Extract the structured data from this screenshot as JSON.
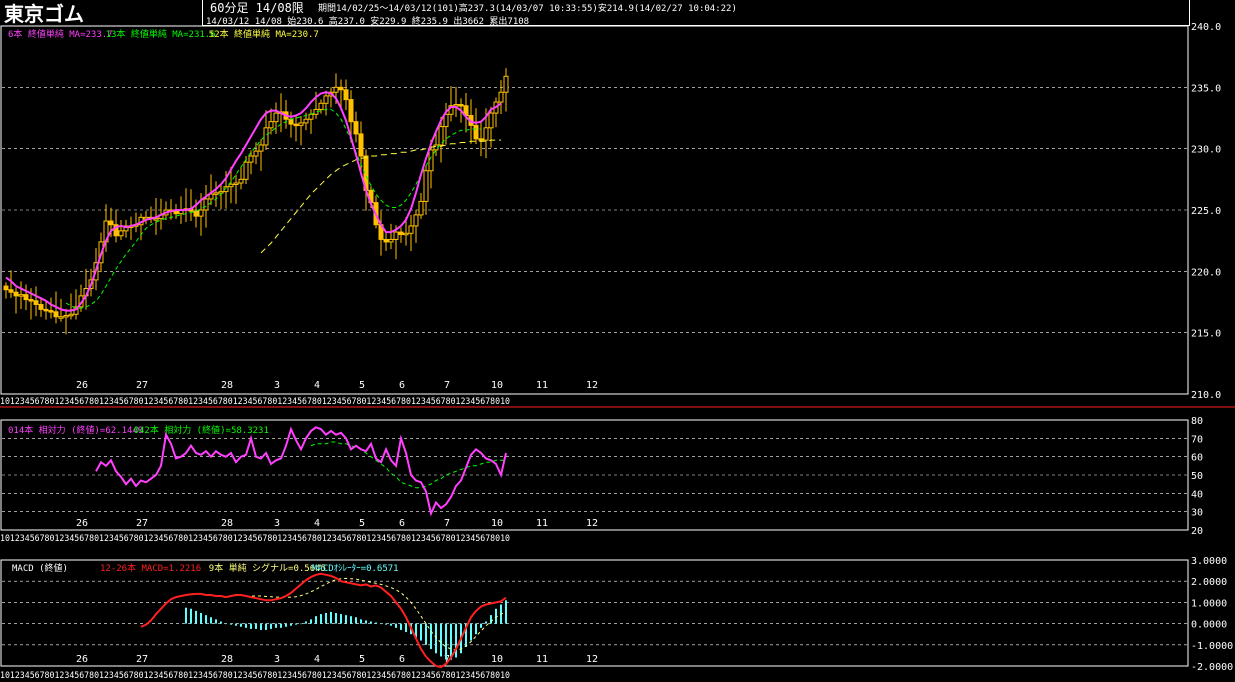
{
  "header": {
    "title": "東京ゴム",
    "timeframe": "60分足 14/08限",
    "period": "期間14/02/25～14/03/12(101)高237.3(14/03/07 10:33:55)安214.9(14/02/27 10:04:22)",
    "last_bar": "14/03/12 14/08 始230.6 高237.0 安229.9 終235.9 出3662 累出7108"
  },
  "colors": {
    "background": "#000000",
    "candle": "#ffc000",
    "ma_fast": "#ff40ff",
    "ma_mid": "#00ff00",
    "ma_slow": "#ffff40",
    "rsi_fast": "#ff40ff",
    "rsi_slow": "#00ff00",
    "macd": "#ff2020",
    "signal": "#ffff80",
    "histogram": "#60ffff",
    "separator": "#ff2020"
  },
  "x_axis": {
    "day_labels": [
      "26",
      "27",
      "28",
      "3",
      "4",
      "5",
      "6",
      "7",
      "10",
      "11",
      "12"
    ],
    "hour_ticks": "1012345678012345678012345678012345678012345678012345678012345678012345678012345678012345678012345678010"
  },
  "chart_data": [
    {
      "type": "candlestick",
      "name": "price",
      "ylim": [
        210,
        240
      ],
      "yticks": [
        "240.0",
        "235.0",
        "230.0",
        "225.0",
        "220.0",
        "215.0",
        "210.0"
      ],
      "legend": [
        {
          "text": "6本 終値単純 MA=233.7",
          "color": "#ff40ff"
        },
        {
          "text": "13本 終値単純 MA=231.6",
          "color": "#00ff00"
        },
        {
          "text": "52本 終値単純 MA=230.7",
          "color": "#ffff40"
        }
      ],
      "close": [
        218.5,
        218.3,
        218.0,
        218.1,
        217.7,
        217.6,
        217.3,
        216.9,
        216.8,
        216.7,
        216.3,
        216.3,
        216.4,
        216.5,
        217.1,
        218.0,
        218.6,
        219.3,
        220.7,
        222.4,
        224.1,
        223.8,
        222.9,
        223.3,
        223.7,
        223.7,
        223.8,
        224.4,
        224.4,
        224.3,
        224.3,
        224.6,
        225.0,
        224.9,
        224.7,
        225.0,
        225.1,
        224.9,
        224.5,
        225.0,
        225.9,
        226.3,
        226.4,
        226.5,
        226.9,
        227.1,
        227.2,
        227.5,
        228.9,
        229.4,
        229.8,
        230.3,
        231.7,
        232.2,
        232.9,
        233.0,
        232.4,
        232.0,
        231.9,
        232.1,
        232.4,
        232.8,
        233.2,
        233.7,
        234.3,
        234.6,
        235.0,
        234.8,
        234.0,
        232.2,
        231.2,
        229.4,
        226.6,
        225.6,
        223.8,
        222.6,
        222.4,
        222.6,
        223.2,
        223.0,
        223.1,
        223.7,
        224.6,
        225.7,
        228.2,
        229.9,
        230.3,
        231.8,
        232.8,
        233.5,
        233.6,
        233.5,
        232.7,
        231.9,
        230.8,
        230.7,
        231.7,
        232.9,
        233.8,
        234.6,
        235.9
      ],
      "ma6": [
        219.5,
        219.2,
        218.8,
        218.6,
        218.4,
        218.2,
        218.0,
        217.8,
        217.6,
        217.3,
        217.1,
        216.9,
        216.8,
        216.8,
        216.9,
        217.4,
        218.0,
        218.9,
        220.1,
        221.4,
        222.5,
        223.3,
        223.6,
        223.7,
        223.6,
        223.7,
        223.8,
        224.0,
        224.2,
        224.3,
        224.4,
        224.6,
        224.8,
        224.9,
        225.0,
        225.0,
        225.0,
        225.1,
        225.4,
        225.8,
        226.1,
        226.4,
        226.7,
        227.1,
        227.6,
        228.3,
        229.0,
        229.6,
        230.3,
        231.0,
        231.7,
        232.4,
        232.9,
        233.1,
        233.1,
        232.9,
        232.7,
        232.6,
        232.7,
        232.9,
        233.3,
        233.8,
        234.2,
        234.5,
        234.6,
        234.5,
        234.1,
        233.3,
        232.3,
        230.9,
        229.5,
        228.0,
        226.6,
        225.5,
        224.6,
        223.8,
        223.2,
        223.2,
        223.4,
        223.7,
        224.2,
        225.1,
        226.4,
        227.9,
        229.2,
        230.4,
        231.4,
        232.3,
        233.0,
        233.4,
        233.4,
        233.1,
        232.6,
        232.2,
        232.1,
        232.2,
        232.6,
        233.2,
        233.4,
        233.7
      ],
      "ma13": [
        null,
        null,
        null,
        null,
        null,
        null,
        null,
        null,
        null,
        null,
        null,
        null,
        217.4,
        217.2,
        217.0,
        217.0,
        217.1,
        217.3,
        217.6,
        218.1,
        218.8,
        219.5,
        220.2,
        220.8,
        221.4,
        221.9,
        222.4,
        223.0,
        223.5,
        223.8,
        224.0,
        224.2,
        224.3,
        224.4,
        224.5,
        224.6,
        224.7,
        224.8,
        224.9,
        225.1,
        225.3,
        225.6,
        225.9,
        226.3,
        226.8,
        227.3,
        227.9,
        228.5,
        229.1,
        229.7,
        230.2,
        230.7,
        231.1,
        231.4,
        231.7,
        232.0,
        232.2,
        232.4,
        232.5,
        232.6,
        232.7,
        232.8,
        233.0,
        233.1,
        233.2,
        233.2,
        232.9,
        232.4,
        231.6,
        230.7,
        229.7,
        228.7,
        227.8,
        227.0,
        226.3,
        225.8,
        225.4,
        225.2,
        225.2,
        225.4,
        225.8,
        226.4,
        227.1,
        227.9,
        228.6,
        229.3,
        229.9,
        230.4,
        230.8,
        231.1,
        231.3,
        231.5,
        231.5,
        231.6,
        231.6,
        231.6
      ],
      "ma52": [
        null,
        null,
        null,
        null,
        null,
        null,
        null,
        null,
        null,
        null,
        null,
        null,
        null,
        null,
        null,
        null,
        null,
        null,
        null,
        null,
        null,
        null,
        null,
        null,
        null,
        null,
        null,
        null,
        null,
        null,
        null,
        null,
        null,
        null,
        null,
        null,
        null,
        null,
        null,
        null,
        null,
        null,
        null,
        null,
        null,
        null,
        null,
        null,
        null,
        null,
        null,
        221.5,
        221.9,
        222.3,
        222.8,
        223.3,
        223.8,
        224.3,
        224.8,
        225.3,
        225.8,
        226.3,
        226.7,
        227.1,
        227.5,
        227.9,
        228.2,
        228.5,
        228.7,
        228.9,
        229.1,
        229.2,
        229.3,
        229.4,
        229.4,
        229.5,
        229.5,
        229.6,
        229.6,
        229.7,
        229.7,
        229.8,
        229.9,
        229.9,
        230.0,
        230.1,
        230.2,
        230.2,
        230.3,
        230.4,
        230.4,
        230.5,
        230.5,
        230.6,
        230.6,
        230.6,
        230.6,
        230.7,
        230.7,
        230.7
      ]
    },
    {
      "type": "line",
      "name": "relative strength",
      "ylim": [
        20,
        80
      ],
      "yticks": [
        "80",
        "70",
        "60",
        "50",
        "40",
        "30",
        "20"
      ],
      "legend": [
        {
          "text": "014本 相対力 (終値)=62.1449",
          "color": "#ff40ff"
        },
        {
          "text": "042本 相対力 (終値)=58.3231",
          "color": "#00ff00"
        }
      ],
      "rsi14": [
        null,
        null,
        null,
        null,
        null,
        null,
        null,
        null,
        null,
        null,
        null,
        null,
        null,
        null,
        null,
        null,
        null,
        null,
        52,
        57,
        55,
        58,
        52,
        49,
        45,
        48,
        44,
        47,
        46,
        48,
        50,
        55,
        72,
        67,
        59,
        60,
        62,
        66,
        62,
        61,
        63,
        60,
        63,
        61,
        60,
        62,
        57,
        60,
        61,
        70,
        60,
        59,
        62,
        56,
        58,
        59,
        66,
        75,
        69,
        64,
        70,
        74,
        76,
        75,
        72,
        74,
        72,
        73,
        70,
        64,
        66,
        64,
        63,
        67,
        59,
        57,
        64,
        58,
        55,
        70,
        62,
        50,
        47,
        46,
        41,
        29,
        35,
        32,
        34,
        38,
        44,
        47,
        54,
        61,
        64,
        62,
        59,
        58,
        56,
        50,
        62
      ],
      "rsi42": [
        null,
        null,
        null,
        null,
        null,
        null,
        null,
        null,
        null,
        null,
        null,
        null,
        null,
        null,
        null,
        null,
        null,
        null,
        null,
        null,
        null,
        null,
        null,
        null,
        null,
        null,
        null,
        null,
        null,
        null,
        null,
        null,
        null,
        null,
        null,
        null,
        null,
        null,
        null,
        null,
        null,
        null,
        null,
        null,
        null,
        null,
        null,
        null,
        null,
        null,
        null,
        null,
        null,
        null,
        null,
        null,
        null,
        null,
        null,
        null,
        null,
        66,
        67,
        67,
        67,
        68,
        68,
        67,
        67,
        66,
        65,
        64,
        62,
        60,
        58,
        56,
        54,
        51,
        49,
        46,
        45,
        44,
        43,
        43,
        44,
        45,
        47,
        48,
        50,
        51,
        52,
        53,
        54,
        55,
        55,
        56,
        57,
        57,
        58,
        58,
        58
      ]
    },
    {
      "type": "line",
      "name": "MACD",
      "ylim": [
        -2,
        3
      ],
      "yticks": [
        "3.0000",
        "2.0000",
        "1.0000",
        "0.0000",
        "-1.0000",
        "-2.0000"
      ],
      "legend_title": "MACD (終値)",
      "legend": [
        {
          "text": "12-26本 MACD=1.2216",
          "color": "#ff2020"
        },
        {
          "text": "9本 単純 シグナル=0.5645",
          "color": "#ffff80"
        },
        {
          "text": "MACDｵｼﾚｰﾀｰ=0.6571",
          "color": "#60ffff"
        }
      ],
      "macd": [
        null,
        null,
        null,
        null,
        null,
        null,
        null,
        null,
        null,
        null,
        null,
        null,
        null,
        null,
        null,
        null,
        null,
        null,
        null,
        null,
        null,
        null,
        null,
        null,
        null,
        null,
        null,
        -0.15,
        -0.05,
        0.15,
        0.45,
        0.7,
        0.95,
        1.15,
        1.25,
        1.3,
        1.35,
        1.38,
        1.4,
        1.4,
        1.35,
        1.35,
        1.3,
        1.3,
        1.25,
        1.3,
        1.35,
        1.35,
        1.3,
        1.25,
        1.2,
        1.15,
        1.1,
        1.1,
        1.15,
        1.2,
        1.3,
        1.45,
        1.65,
        1.85,
        2.05,
        2.2,
        2.3,
        2.35,
        2.3,
        2.25,
        2.15,
        2.0,
        1.95,
        1.9,
        1.85,
        1.8,
        1.85,
        1.75,
        1.8,
        1.7,
        1.5,
        1.3,
        1.0,
        0.7,
        0.3,
        -0.2,
        -0.7,
        -1.2,
        -1.55,
        -1.8,
        -2.0,
        -2.05,
        -1.9,
        -1.6,
        -1.2,
        -0.7,
        -0.2,
        0.3,
        0.6,
        0.8,
        0.9,
        0.95,
        1.0,
        1.05,
        1.22
      ],
      "signal": [
        null,
        null,
        null,
        null,
        null,
        null,
        null,
        null,
        null,
        null,
        null,
        null,
        null,
        null,
        null,
        null,
        null,
        null,
        null,
        null,
        null,
        null,
        null,
        null,
        null,
        null,
        null,
        null,
        null,
        null,
        null,
        null,
        null,
        null,
        null,
        null,
        null,
        null,
        null,
        null,
        null,
        null,
        null,
        null,
        null,
        null,
        null,
        null,
        1.3,
        1.3,
        1.3,
        1.3,
        1.28,
        1.27,
        1.25,
        1.25,
        1.24,
        1.25,
        1.27,
        1.32,
        1.4,
        1.5,
        1.62,
        1.75,
        1.87,
        1.98,
        2.07,
        2.12,
        2.13,
        2.12,
        2.1,
        2.05,
        2.0,
        1.95,
        1.9,
        1.85,
        1.78,
        1.7,
        1.6,
        1.45,
        1.25,
        1.0,
        0.7,
        0.35,
        0.0,
        -0.35,
        -0.65,
        -0.9,
        -1.1,
        -1.2,
        -1.25,
        -1.2,
        -1.05,
        -0.85,
        -0.6,
        -0.35,
        -0.1,
        0.1,
        0.3,
        0.45,
        0.56
      ],
      "histogram": [
        null,
        null,
        null,
        null,
        null,
        null,
        null,
        null,
        null,
        null,
        null,
        null,
        null,
        null,
        null,
        null,
        null,
        null,
        null,
        null,
        null,
        null,
        null,
        null,
        null,
        null,
        null,
        null,
        null,
        null,
        null,
        null,
        null,
        null,
        null,
        null,
        0.75,
        0.7,
        0.6,
        0.5,
        0.4,
        0.3,
        0.2,
        0.1,
        0.0,
        -0.05,
        -0.1,
        -0.15,
        -0.2,
        -0.25,
        -0.25,
        -0.3,
        -0.3,
        -0.25,
        -0.2,
        -0.2,
        -0.15,
        -0.1,
        -0.05,
        0.0,
        0.1,
        0.2,
        0.35,
        0.45,
        0.5,
        0.55,
        0.5,
        0.45,
        0.4,
        0.35,
        0.3,
        0.2,
        0.15,
        0.1,
        0.05,
        0.0,
        -0.05,
        -0.1,
        -0.2,
        -0.3,
        -0.4,
        -0.5,
        -0.65,
        -0.8,
        -1.0,
        -1.2,
        -1.4,
        -1.55,
        -1.7,
        -1.7,
        -1.6,
        -1.4,
        -1.1,
        -0.8,
        -0.5,
        -0.2,
        0.1,
        0.4,
        0.7,
        0.9,
        1.1
      ]
    }
  ]
}
